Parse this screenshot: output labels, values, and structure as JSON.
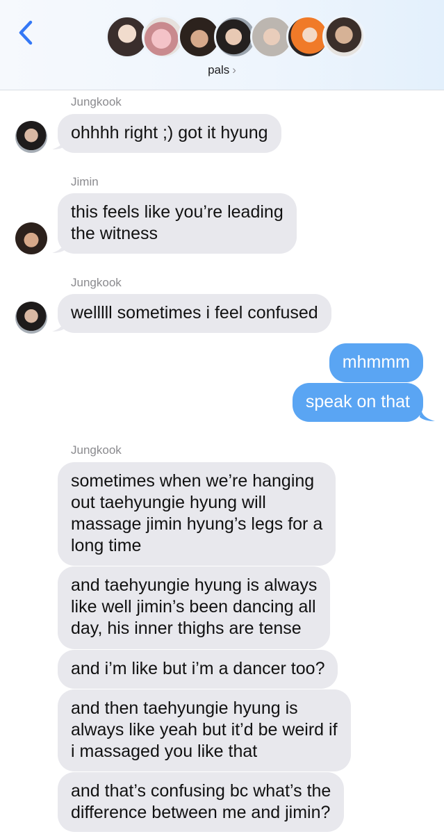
{
  "header": {
    "group_name": "pals",
    "chevron": "›",
    "back_icon": "chevron-left-icon",
    "accent_color": "#3478f6",
    "avatar_count": 7
  },
  "messages": [
    {
      "sender": "Jungkook",
      "text": "ohhhh right ;) got it hyung"
    },
    {
      "sender": "Jimin",
      "lines": [
        "this feels like you’re leading",
        "the witness"
      ]
    },
    {
      "sender": "Jungkook",
      "text": "welllll sometimes i feel confused"
    },
    {
      "outgoing": true,
      "text": "mhmmm"
    },
    {
      "outgoing": true,
      "text": "speak on that"
    },
    {
      "sender": "Jungkook",
      "lines": [
        "sometimes when we’re hanging",
        "out taehyungie hyung will",
        "massage jimin hyung’s legs for a",
        "long time"
      ]
    },
    {
      "lines": [
        "and taehyungie hyung is always",
        "like well jimin’s been dancing all",
        "day, his inner thighs are tense"
      ]
    },
    {
      "text": "and i’m like but i’m a dancer too?"
    },
    {
      "lines": [
        "and then taehyungie hyung is",
        "always like yeah but it’d be weird if",
        "i massaged you like that"
      ]
    },
    {
      "lines": [
        "and that’s confusing bc what’s the",
        "difference between me and jimin?"
      ]
    }
  ],
  "colors": {
    "incoming_bubble": "#e8e8ed",
    "outgoing_bubble": "#5aa5f3",
    "sender_label": "#8a8a8e"
  }
}
